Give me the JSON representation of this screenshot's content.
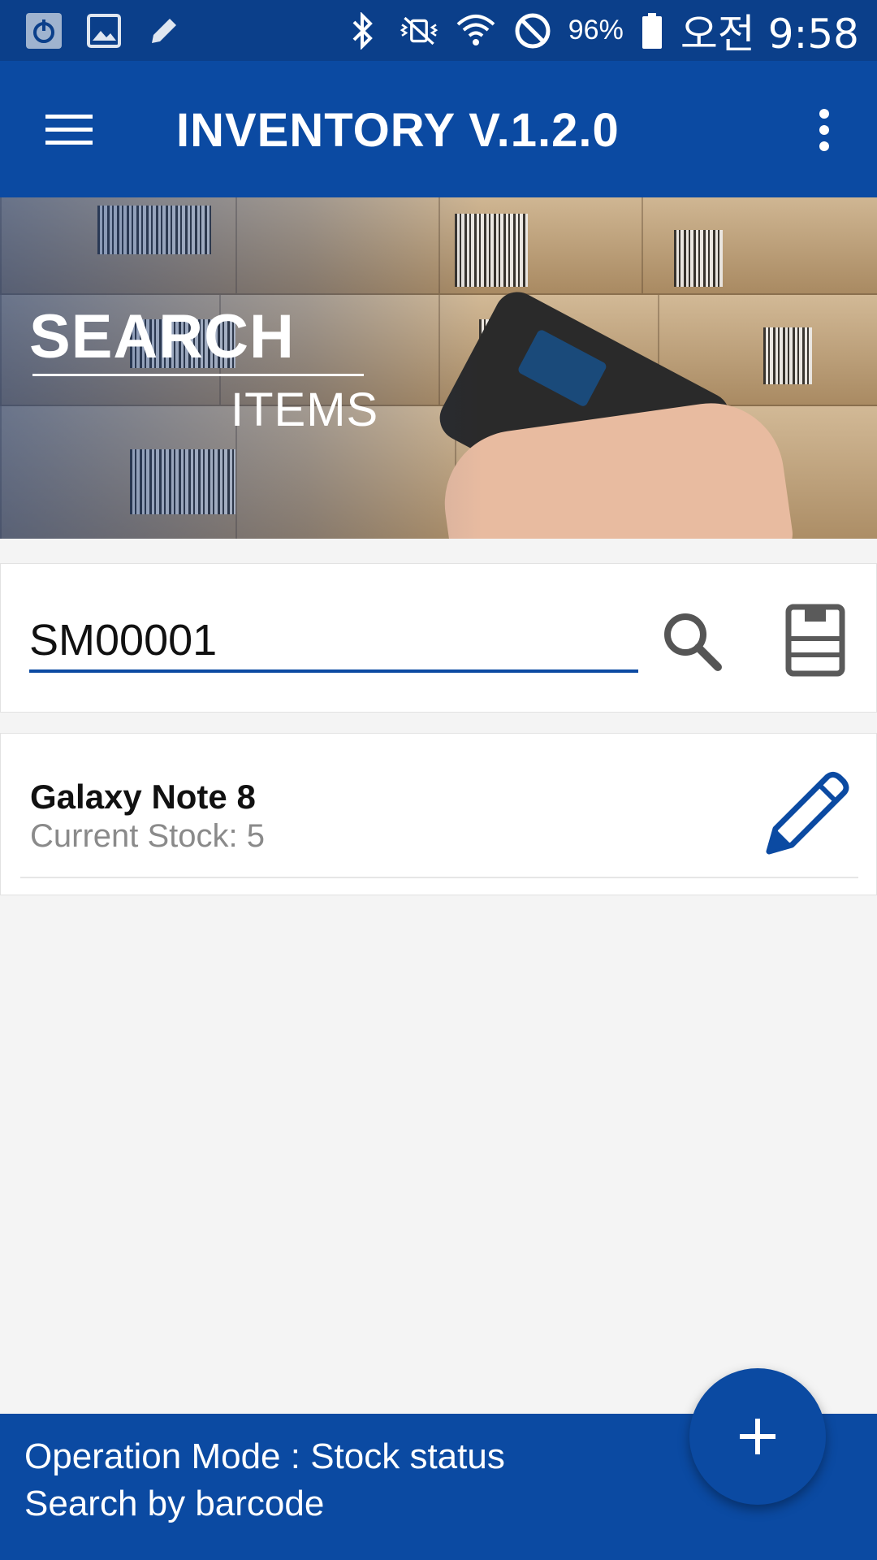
{
  "status_bar": {
    "icons_left": [
      "power-notification-icon",
      "image-notification-icon",
      "pencil-notification-icon"
    ],
    "icons_right": [
      "bluetooth-icon",
      "vibrate-mute-icon",
      "wifi-icon",
      "do-not-disturb-icon",
      "battery-icon"
    ],
    "battery": "96%",
    "time": "오전 9:58"
  },
  "app_bar": {
    "title": "INVENTORY V.1.2.0",
    "menu_icon": "hamburger-menu-icon",
    "overflow_icon": "more-vertical-icon"
  },
  "banner": {
    "title": "SEARCH",
    "subtitle": "ITEMS"
  },
  "search": {
    "value": "SM00001",
    "search_icon": "search-icon",
    "scan_icon": "barcode-scanner-icon"
  },
  "results": [
    {
      "name": "Galaxy Note 8",
      "stock": "Current Stock: 5",
      "action_icon": "edit-pencil-icon"
    }
  ],
  "bottom_bar": {
    "operation_mode": "Operation Mode : Stock status",
    "search_mode": "Search by barcode"
  },
  "fab": {
    "label": "+",
    "icon": "add-icon"
  },
  "colors": {
    "primary": "#0b4aa2",
    "status_bar": "#0b3f8a",
    "background": "#f4f4f4"
  }
}
